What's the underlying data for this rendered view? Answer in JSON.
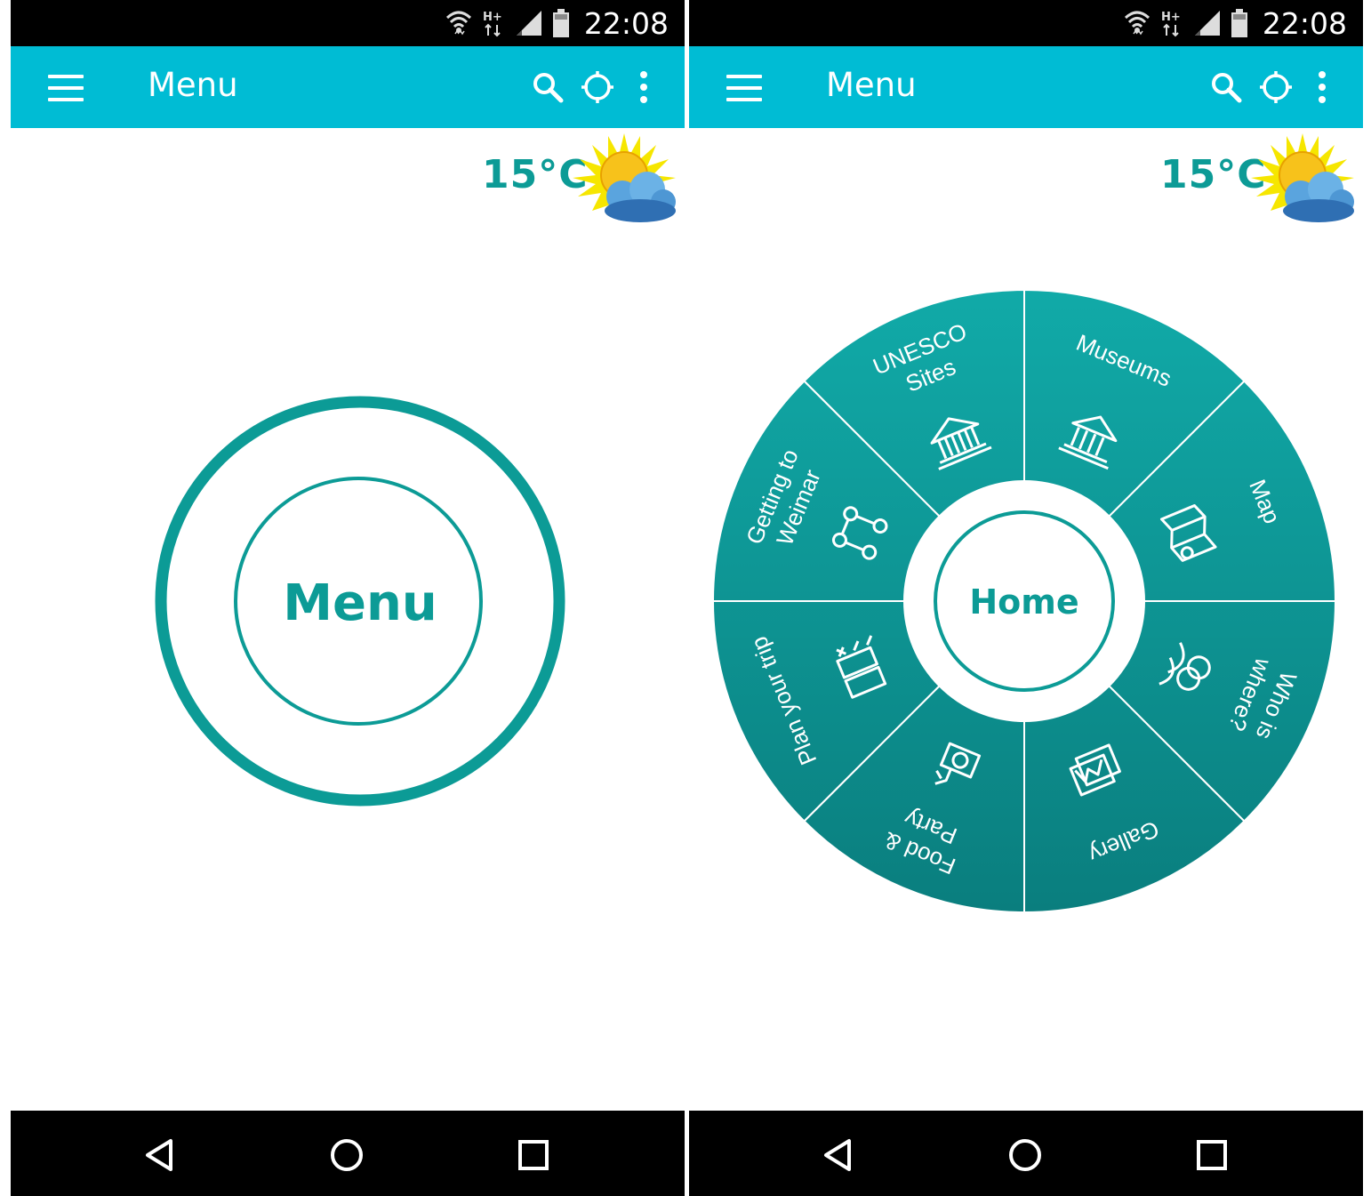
{
  "status_bar": {
    "time": "22:08",
    "network_type": "H+"
  },
  "app_bar": {
    "title": "Menu",
    "icons": [
      "menu-icon",
      "search-icon",
      "gps-icon",
      "overflow-menu-icon"
    ]
  },
  "weather": {
    "temperature": "15°C",
    "condition_icon": "partly-cloudy-icon"
  },
  "left_screen": {
    "center_button_label": "Menu"
  },
  "right_screen": {
    "center_button_label": "Home",
    "wheel_items": [
      {
        "label_line1": "Museums",
        "label_line2": "",
        "icon": "museum-icon"
      },
      {
        "label_line1": "Map",
        "label_line2": "",
        "icon": "map-icon"
      },
      {
        "label_line1": "Who is",
        "label_line2": "where?",
        "icon": "people-icon"
      },
      {
        "label_line1": "Gallery",
        "label_line2": "",
        "icon": "gallery-icon"
      },
      {
        "label_line1": "Food &",
        "label_line2": "Party",
        "icon": "food-party-icon"
      },
      {
        "label_line1": "Plan your trip",
        "label_line2": "",
        "icon": "checklist-icon"
      },
      {
        "label_line1": "Getting to",
        "label_line2": "Weimar",
        "icon": "route-icon"
      },
      {
        "label_line1": "UNESCO",
        "label_line2": "Sites",
        "icon": "unesco-icon"
      }
    ]
  },
  "nav_bar": {
    "buttons": [
      "back-icon",
      "home-icon",
      "recents-icon"
    ]
  },
  "colors": {
    "app_bar": "#00bcd4",
    "accent": "#0c9b96",
    "wheel_top": "#11aaa8",
    "wheel_bottom": "#0a7e7e"
  }
}
